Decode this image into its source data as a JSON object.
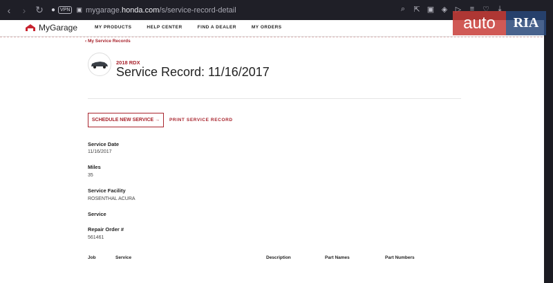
{
  "browser": {
    "vpn": "VPN",
    "url_prefix": "mygarage.",
    "url_domain": "honda.com",
    "url_path": "/s/service-record-detail"
  },
  "site": {
    "logo_text": "MyGarage",
    "nav": [
      "MY PRODUCTS",
      "HELP CENTER",
      "FIND A DEALER",
      "MY ORDERS"
    ]
  },
  "breadcrumb": "‹ My Service Records",
  "vehicle": {
    "model": "2018 RDX",
    "title": "Service Record: 11/16/2017"
  },
  "actions": {
    "schedule": "SCHEDULE NEW SERVICE →",
    "print": "PRINT SERVICE RECORD"
  },
  "fields": {
    "service_date_label": "Service Date",
    "service_date_value": "11/16/2017",
    "miles_label": "Miles",
    "miles_value": "35",
    "facility_label": "Service Facility",
    "facility_value": "ROSENTHAL ACURA",
    "service_label": "Service",
    "repair_label": "Repair Order #",
    "repair_value": "561461"
  },
  "table": {
    "columns": [
      "Job",
      "Service",
      "Description",
      "Part Names",
      "Part Numbers"
    ]
  },
  "watermark": {
    "auto": "auto",
    "ria": "RIA"
  },
  "colors": {
    "accent": "#a8232c",
    "chrome": "#1f1f27"
  }
}
